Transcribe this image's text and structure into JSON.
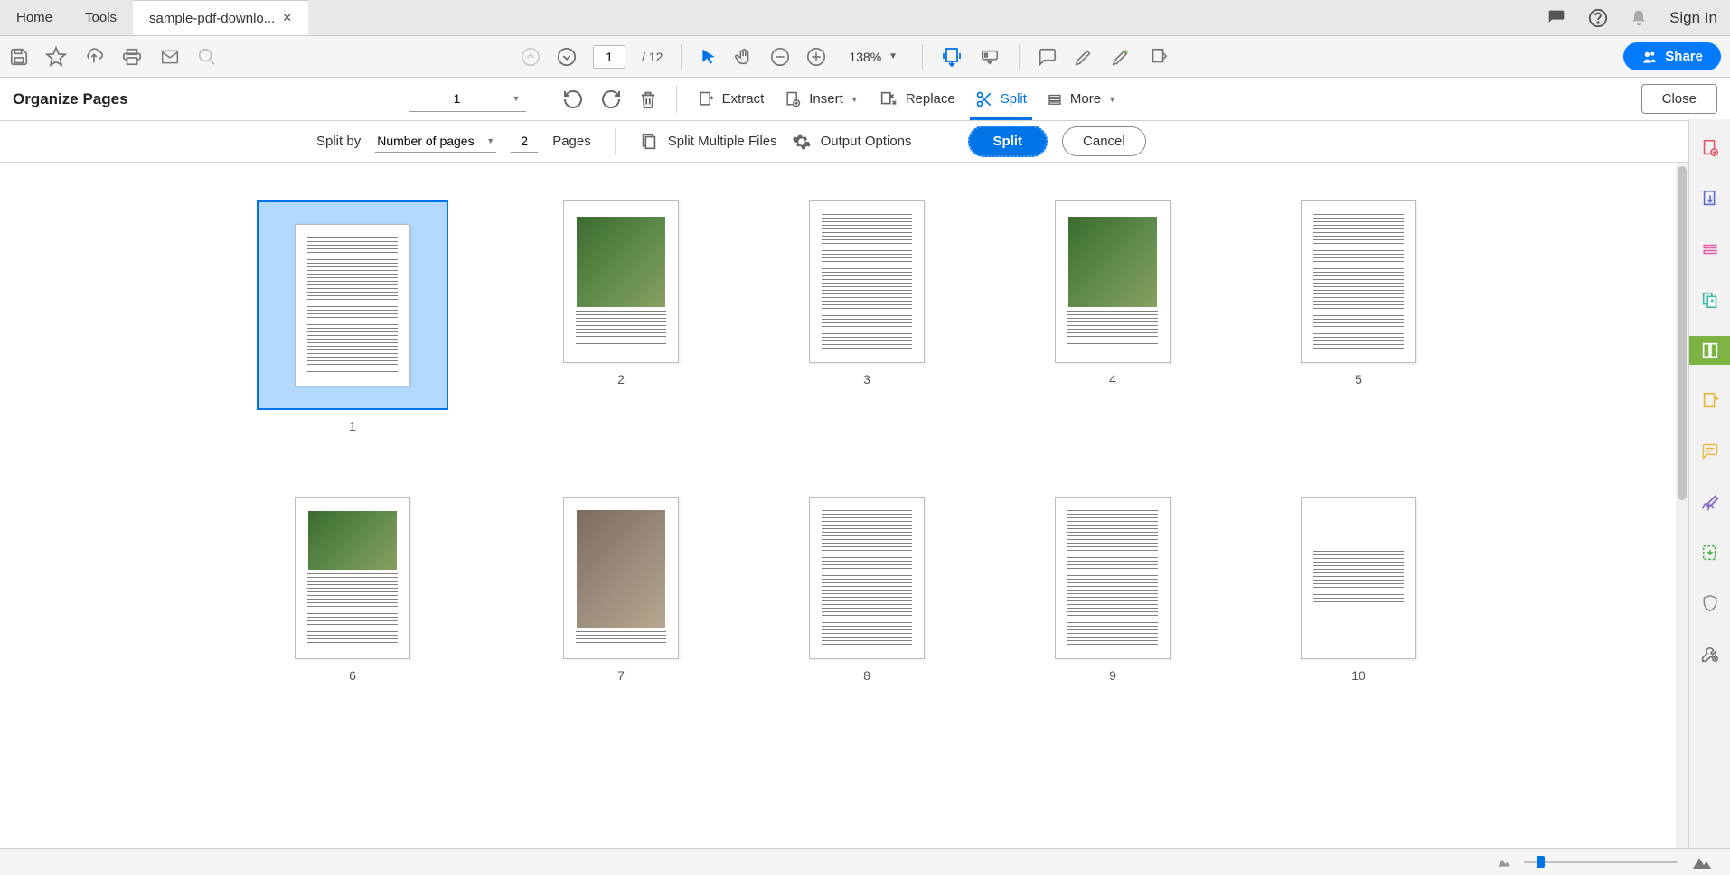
{
  "tabs": {
    "home": "Home",
    "tools": "Tools",
    "file": "sample-pdf-downlo..."
  },
  "top_right": {
    "signin": "Sign In"
  },
  "toolbar": {
    "page_current": "1",
    "page_total": "/ 12",
    "zoom": "138%"
  },
  "share": {
    "label": "Share"
  },
  "organize": {
    "title": "Organize Pages",
    "page_select": "1",
    "extract": "Extract",
    "insert": "Insert",
    "replace": "Replace",
    "split": "Split",
    "more": "More",
    "close": "Close"
  },
  "split_bar": {
    "split_by": "Split by",
    "method": "Number of pages",
    "value": "2",
    "pages_label": "Pages",
    "multiple": "Split Multiple Files",
    "output": "Output Options",
    "split_btn": "Split",
    "cancel_btn": "Cancel"
  },
  "thumbs": {
    "p1": "1",
    "p2": "2",
    "p3": "3",
    "p4": "4",
    "p5": "5",
    "p6": "6",
    "p7": "7",
    "p8": "8",
    "p9": "9",
    "p10": "10"
  }
}
